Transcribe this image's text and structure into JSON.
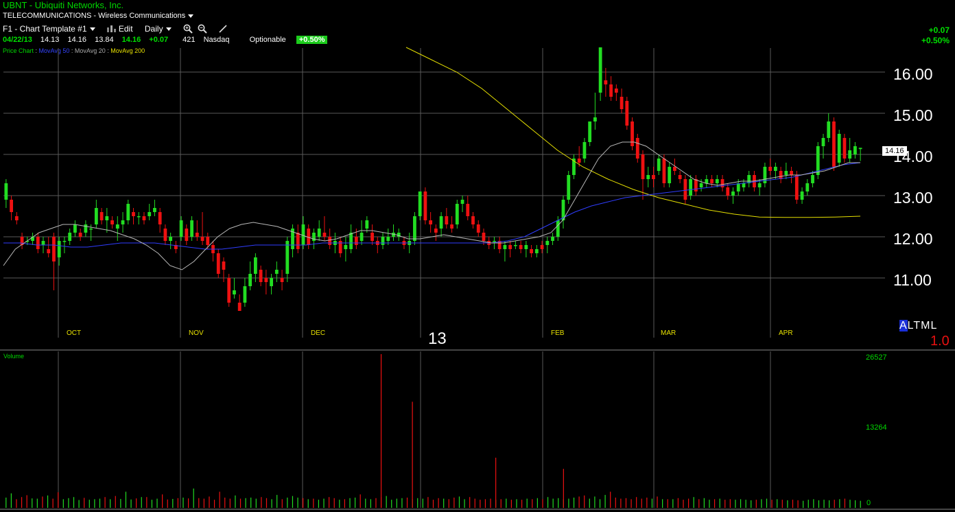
{
  "header": {
    "symbol": "UBNT",
    "company": "Ubiquiti Networks, Inc.",
    "industry": "TELECOMMUNICATIONS - Wireless Communications"
  },
  "toolbar": {
    "template": "F1 - Chart Template #1",
    "edit_label": "Edit",
    "period_label": "Daily",
    "icons": [
      "zoom-in-icon",
      "zoom-out-icon",
      "draw-icon"
    ]
  },
  "quote": {
    "date": "04/22/13",
    "open": "14.13",
    "high": "14.16",
    "low": "13.84",
    "last": "14.16",
    "change": "+0.07",
    "volume": "421",
    "exchange": "Nasdaq",
    "optionable": "Optionable",
    "pct_badge": "+0.50%"
  },
  "right_change": {
    "abs": "+0.07",
    "pct": "+0.50%"
  },
  "legend": {
    "price_chart": "Price Chart",
    "ma50": "MovAvg 50",
    "ma20": "MovAvg 20",
    "ma200": "MovAvg 200"
  },
  "price_tag": "14.16",
  "year_label": "13",
  "altml": {
    "a": "A",
    "rest": "LTML",
    "multiplier": "1.0"
  },
  "volume_panel": {
    "label": "Volume",
    "ticks": [
      "26527",
      "13264",
      "0"
    ]
  },
  "colors": {
    "up": "#22dd22",
    "down": "#ee1111",
    "ma50": "#2f3dff",
    "ma20": "#b8b8b8",
    "ma200": "#e6e000",
    "grid": "#5a5a5a"
  },
  "chart_data": {
    "type": "candlestick",
    "x_axis_months": [
      "OCT",
      "NOV",
      "DEC",
      "FEB",
      "MAR",
      "APR"
    ],
    "y_ticks": [
      "16.00",
      "15.00",
      "14.00",
      "13.00",
      "12.00",
      "11.00"
    ],
    "ylim": [
      10.2,
      16.6
    ],
    "candles": [
      [
        12.9,
        13.4,
        12.7,
        13.3
      ],
      [
        12.9,
        13.0,
        12.4,
        12.6
      ],
      [
        12.5,
        12.6,
        12.3,
        12.4
      ],
      [
        12.0,
        12.1,
        11.7,
        11.8
      ],
      [
        11.9,
        12.0,
        11.8,
        11.9
      ],
      [
        11.9,
        12.1,
        11.8,
        12.0
      ],
      [
        12.0,
        12.1,
        11.6,
        11.7
      ],
      [
        11.8,
        12.0,
        11.6,
        11.9
      ],
      [
        11.7,
        12.0,
        11.5,
        11.6
      ],
      [
        12.0,
        12.1,
        10.7,
        11.4
      ],
      [
        11.5,
        12.0,
        11.3,
        11.9
      ],
      [
        11.9,
        12.0,
        11.6,
        11.9
      ],
      [
        11.9,
        12.2,
        11.8,
        12.1
      ],
      [
        12.1,
        12.4,
        12.0,
        12.3
      ],
      [
        12.1,
        12.2,
        11.9,
        12.0
      ],
      [
        12.1,
        12.4,
        12.0,
        12.3
      ],
      [
        12.2,
        12.3,
        11.9,
        12.2
      ],
      [
        12.3,
        12.9,
        12.2,
        12.7
      ],
      [
        12.6,
        12.7,
        12.3,
        12.4
      ],
      [
        12.4,
        12.7,
        12.1,
        12.5
      ],
      [
        12.4,
        12.5,
        12.2,
        12.3
      ],
      [
        12.2,
        12.5,
        11.9,
        12.3
      ],
      [
        12.3,
        12.6,
        12.1,
        12.4
      ],
      [
        12.4,
        12.9,
        12.3,
        12.8
      ],
      [
        12.6,
        12.7,
        12.3,
        12.5
      ],
      [
        12.5,
        12.6,
        12.3,
        12.5
      ],
      [
        12.5,
        12.6,
        12.3,
        12.4
      ],
      [
        12.5,
        12.8,
        12.4,
        12.6
      ],
      [
        12.6,
        12.9,
        12.5,
        12.7
      ],
      [
        12.6,
        12.7,
        12.1,
        12.3
      ],
      [
        12.2,
        12.3,
        11.8,
        11.9
      ],
      [
        11.9,
        12.1,
        11.7,
        12.0
      ],
      [
        11.8,
        11.9,
        11.6,
        11.7
      ],
      [
        12.0,
        12.5,
        11.9,
        12.4
      ],
      [
        12.2,
        12.3,
        11.8,
        11.9
      ],
      [
        12.0,
        12.5,
        11.9,
        12.4
      ],
      [
        12.1,
        12.4,
        11.9,
        12.0
      ],
      [
        12.0,
        12.6,
        11.8,
        11.9
      ],
      [
        12.0,
        12.1,
        11.7,
        11.8
      ],
      [
        11.8,
        11.9,
        11.4,
        11.6
      ],
      [
        11.6,
        11.7,
        11.0,
        11.1
      ],
      [
        11.4,
        11.5,
        10.9,
        11.2
      ],
      [
        11.0,
        11.1,
        10.3,
        10.4
      ],
      [
        10.6,
        11.0,
        10.5,
        10.7
      ],
      [
        10.4,
        10.6,
        10.1,
        10.2
      ],
      [
        10.4,
        11.0,
        10.3,
        10.8
      ],
      [
        10.8,
        11.4,
        10.7,
        11.1
      ],
      [
        11.1,
        11.6,
        10.9,
        11.5
      ],
      [
        11.2,
        11.3,
        10.8,
        10.9
      ],
      [
        11.0,
        11.2,
        10.6,
        10.9
      ],
      [
        10.8,
        11.1,
        10.6,
        11.0
      ],
      [
        11.1,
        11.4,
        10.9,
        11.2
      ],
      [
        11.0,
        11.2,
        10.7,
        10.9
      ],
      [
        11.1,
        12.0,
        10.9,
        11.9
      ],
      [
        11.7,
        12.3,
        11.5,
        12.2
      ],
      [
        12.1,
        12.3,
        11.6,
        11.7
      ],
      [
        11.8,
        12.5,
        11.7,
        12.3
      ],
      [
        12.2,
        12.3,
        11.7,
        11.8
      ],
      [
        11.9,
        12.2,
        11.7,
        12.1
      ],
      [
        12.0,
        12.4,
        11.9,
        12.2
      ],
      [
        12.1,
        12.5,
        11.9,
        12.0
      ],
      [
        12.0,
        12.2,
        11.7,
        11.8
      ],
      [
        11.8,
        12.1,
        11.6,
        11.9
      ],
      [
        11.9,
        12.0,
        11.5,
        11.6
      ],
      [
        11.7,
        12.0,
        11.4,
        11.8
      ],
      [
        11.7,
        12.3,
        11.6,
        12.1
      ],
      [
        12.0,
        12.2,
        11.7,
        11.8
      ],
      [
        11.9,
        12.4,
        11.8,
        12.1
      ],
      [
        12.2,
        12.5,
        12.1,
        12.4
      ],
      [
        12.1,
        12.3,
        11.8,
        11.9
      ],
      [
        11.9,
        12.0,
        11.6,
        11.8
      ],
      [
        11.8,
        12.1,
        11.7,
        12.0
      ],
      [
        11.9,
        12.2,
        11.8,
        12.0
      ],
      [
        12.0,
        12.3,
        11.9,
        12.1
      ],
      [
        12.0,
        12.2,
        11.9,
        12.1
      ],
      [
        11.9,
        12.0,
        11.7,
        11.8
      ],
      [
        11.8,
        12.1,
        11.6,
        11.9
      ],
      [
        11.9,
        12.6,
        11.8,
        12.5
      ],
      [
        12.5,
        13.1,
        12.4,
        13.1
      ],
      [
        13.1,
        13.2,
        12.3,
        12.4
      ],
      [
        12.4,
        12.6,
        12.1,
        12.3
      ],
      [
        12.2,
        12.3,
        11.9,
        12.1
      ],
      [
        12.2,
        12.6,
        12.0,
        12.5
      ],
      [
        12.5,
        12.7,
        12.2,
        12.3
      ],
      [
        12.3,
        12.5,
        12.1,
        12.2
      ],
      [
        12.3,
        12.9,
        12.2,
        12.8
      ],
      [
        12.8,
        13.0,
        12.6,
        12.9
      ],
      [
        12.8,
        13.0,
        12.4,
        12.5
      ],
      [
        12.5,
        12.6,
        12.2,
        12.3
      ],
      [
        12.3,
        12.4,
        12.0,
        12.1
      ],
      [
        12.1,
        12.2,
        11.8,
        11.9
      ],
      [
        11.9,
        12.0,
        11.7,
        11.8
      ],
      [
        11.9,
        12.0,
        11.7,
        11.9
      ],
      [
        11.9,
        12.0,
        11.6,
        11.7
      ],
      [
        11.7,
        11.9,
        11.4,
        11.8
      ],
      [
        11.8,
        11.9,
        11.5,
        11.7
      ],
      [
        11.8,
        11.9,
        11.7,
        11.8
      ],
      [
        11.8,
        11.9,
        11.6,
        11.7
      ],
      [
        11.7,
        11.9,
        11.5,
        11.8
      ],
      [
        11.7,
        11.8,
        11.5,
        11.6
      ],
      [
        11.6,
        11.8,
        11.5,
        11.7
      ],
      [
        11.8,
        11.9,
        11.6,
        11.7
      ],
      [
        11.8,
        12.0,
        11.6,
        11.9
      ],
      [
        11.9,
        12.1,
        11.8,
        12.0
      ],
      [
        12.0,
        12.5,
        11.9,
        12.4
      ],
      [
        12.4,
        13.0,
        12.2,
        12.9
      ],
      [
        12.9,
        13.6,
        12.8,
        13.5
      ],
      [
        13.5,
        14.0,
        13.4,
        13.9
      ],
      [
        13.9,
        14.2,
        13.7,
        13.8
      ],
      [
        13.9,
        14.4,
        13.8,
        14.3
      ],
      [
        14.3,
        14.8,
        14.2,
        14.8
      ],
      [
        14.8,
        15.5,
        14.6,
        14.9
      ],
      [
        15.5,
        16.6,
        15.3,
        16.6
      ],
      [
        15.8,
        16.1,
        15.4,
        15.7
      ],
      [
        15.7,
        15.9,
        15.3,
        15.4
      ],
      [
        15.6,
        15.7,
        15.3,
        15.5
      ],
      [
        15.4,
        15.6,
        15.0,
        15.1
      ],
      [
        15.3,
        15.4,
        14.6,
        14.7
      ],
      [
        14.8,
        14.9,
        14.1,
        14.2
      ],
      [
        14.4,
        14.5,
        13.8,
        13.9
      ],
      [
        14.0,
        14.1,
        12.9,
        13.4
      ],
      [
        13.4,
        13.7,
        13.2,
        13.5
      ],
      [
        13.5,
        13.7,
        13.2,
        13.4
      ],
      [
        13.6,
        14.0,
        13.5,
        13.9
      ],
      [
        13.9,
        14.0,
        13.2,
        13.3
      ],
      [
        13.3,
        13.8,
        13.2,
        13.7
      ],
      [
        13.7,
        13.9,
        13.5,
        13.6
      ],
      [
        13.5,
        13.6,
        13.3,
        13.4
      ],
      [
        13.4,
        13.5,
        12.8,
        12.9
      ],
      [
        13.0,
        13.5,
        12.9,
        13.4
      ],
      [
        13.4,
        13.5,
        13.0,
        13.1
      ],
      [
        13.2,
        13.4,
        13.1,
        13.3
      ],
      [
        13.3,
        13.5,
        13.2,
        13.4
      ],
      [
        13.4,
        13.5,
        13.2,
        13.3
      ],
      [
        13.3,
        13.5,
        13.2,
        13.4
      ],
      [
        13.4,
        13.5,
        13.1,
        13.2
      ],
      [
        13.2,
        13.3,
        12.9,
        13.0
      ],
      [
        13.0,
        13.2,
        12.8,
        13.1
      ],
      [
        13.1,
        13.4,
        13.0,
        13.3
      ],
      [
        13.2,
        13.4,
        13.1,
        13.3
      ],
      [
        13.3,
        13.6,
        13.2,
        13.5
      ],
      [
        13.5,
        13.6,
        13.1,
        13.2
      ],
      [
        13.2,
        13.4,
        13.0,
        13.3
      ],
      [
        13.3,
        13.8,
        13.2,
        13.7
      ],
      [
        13.7,
        13.9,
        13.5,
        13.6
      ],
      [
        13.6,
        13.8,
        13.4,
        13.7
      ],
      [
        13.6,
        13.7,
        13.3,
        13.4
      ],
      [
        13.5,
        13.8,
        13.4,
        13.6
      ],
      [
        13.6,
        13.7,
        13.3,
        13.5
      ],
      [
        13.5,
        13.6,
        12.8,
        12.9
      ],
      [
        12.9,
        13.2,
        12.8,
        13.1
      ],
      [
        13.1,
        13.4,
        13.0,
        13.3
      ],
      [
        13.3,
        13.6,
        13.2,
        13.5
      ],
      [
        13.5,
        14.3,
        13.4,
        14.2
      ],
      [
        14.2,
        14.5,
        13.9,
        14.4
      ],
      [
        14.4,
        15.0,
        14.3,
        14.8
      ],
      [
        14.8,
        14.9,
        13.6,
        13.7
      ],
      [
        13.8,
        14.6,
        13.7,
        14.5
      ],
      [
        14.4,
        14.5,
        13.8,
        13.9
      ],
      [
        13.9,
        14.4,
        13.8,
        14.1
      ],
      [
        14.0,
        14.3,
        13.9,
        14.2
      ],
      [
        14.13,
        14.16,
        13.84,
        14.16
      ]
    ],
    "ma20": [
      11.3,
      11.7,
      11.9,
      12.1,
      12.2,
      12.3,
      12.3,
      12.25,
      12.2,
      12.15,
      12.05,
      11.95,
      11.8,
      11.6,
      11.3,
      11.2,
      11.4,
      11.7,
      12.0,
      12.2,
      12.3,
      12.35,
      12.3,
      12.25,
      12.15,
      12.05,
      11.95,
      11.9,
      11.95,
      12.05,
      12.15,
      12.15,
      12.1,
      12.05,
      11.95,
      11.95,
      12.0,
      12.05,
      12.0,
      11.95,
      11.9,
      11.85,
      11.85,
      11.9,
      11.95,
      12.0,
      12.1,
      12.4,
      12.9,
      13.4,
      13.9,
      14.2,
      14.3,
      14.3,
      14.2,
      14.0,
      13.8,
      13.6,
      13.4,
      13.3,
      13.25,
      13.3,
      13.35,
      13.35,
      13.4,
      13.45,
      13.5,
      13.5,
      13.55,
      13.6,
      13.7,
      13.8,
      13.8
    ],
    "ma50": [
      11.85,
      11.85,
      11.8,
      11.8,
      11.75,
      11.75,
      11.8,
      11.85,
      11.85,
      11.85,
      11.8,
      11.75,
      11.7,
      11.7,
      11.75,
      11.8,
      11.8,
      11.8,
      11.8,
      11.85,
      11.85,
      11.85,
      11.85,
      11.85,
      11.85,
      11.85,
      11.85,
      11.85,
      11.85,
      11.85,
      11.9,
      12.0,
      12.2,
      12.4,
      12.6,
      12.75,
      12.85,
      12.95,
      13.0,
      13.05,
      13.1,
      13.15,
      13.2,
      13.25,
      13.3,
      13.35,
      13.4,
      13.45,
      13.55,
      13.65,
      13.75,
      13.8
    ],
    "ma200": [
      16.6,
      16.3,
      16.0,
      15.6,
      15.1,
      14.6,
      14.1,
      13.7,
      13.4,
      13.15,
      12.95,
      12.8,
      12.65,
      12.55,
      12.48,
      12.47,
      12.47,
      12.48,
      12.5
    ],
    "volumes": [
      18,
      34,
      12,
      20,
      27,
      15,
      14,
      22,
      26,
      14,
      38,
      12,
      16,
      20,
      9,
      17,
      10,
      12,
      14,
      20,
      12,
      24,
      13,
      40,
      11,
      15,
      20,
      20,
      10,
      14,
      30,
      11,
      13,
      16,
      18,
      15,
      52,
      16,
      14,
      22,
      10,
      40,
      18,
      14,
      26,
      14,
      16,
      18,
      14,
      20,
      16,
      12,
      28,
      12,
      18,
      24,
      18,
      16,
      12,
      14,
      10,
      14,
      20,
      16,
      10,
      12,
      16,
      18,
      30,
      14,
      12,
      16,
      20,
      24,
      10,
      14,
      16,
      18,
      12,
      16,
      14,
      20,
      10,
      16,
      14,
      12,
      18,
      22,
      12,
      20,
      14,
      10,
      12,
      14,
      10,
      12,
      14,
      10,
      12,
      10,
      14,
      12,
      16,
      12,
      20,
      14,
      16,
      12,
      14,
      18,
      22,
      26,
      14,
      22,
      12,
      28,
      40,
      18,
      14,
      16,
      12,
      20,
      14,
      18,
      14,
      22,
      12,
      12,
      12,
      16,
      10,
      14,
      20,
      12,
      16,
      10,
      12,
      14,
      10,
      12,
      10,
      12,
      10,
      8,
      10,
      12,
      14,
      10,
      12,
      10,
      8,
      10,
      8,
      6,
      10,
      12,
      8,
      10,
      8,
      10,
      12,
      14,
      10,
      8,
      6
    ],
    "volume_spikes": [
      [
        72,
        26527
      ],
      [
        78,
        18000
      ],
      [
        94,
        8000
      ],
      [
        107,
        6000
      ]
    ],
    "volume_range": [
      0,
      26527
    ]
  }
}
